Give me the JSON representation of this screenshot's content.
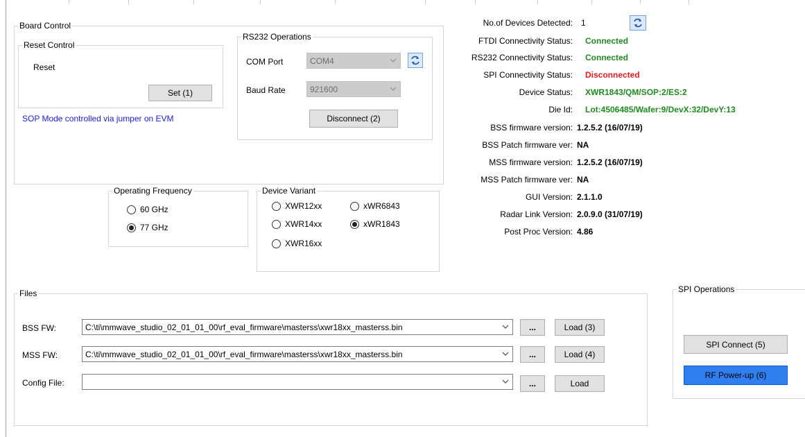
{
  "board_control": {
    "title": "Board Control",
    "reset_group": "Reset Control",
    "reset_label": "Reset",
    "set_button": "Set (1)",
    "sop_note": "SOP Mode controlled via jumper on EVM"
  },
  "rs232": {
    "title": "RS232 Operations",
    "com_port_label": "COM Port",
    "com_port_value": "COM4",
    "baud_rate_label": "Baud Rate",
    "baud_rate_value": "921600",
    "disconnect_button": "Disconnect (2)"
  },
  "operating_frequency": {
    "title": "Operating Frequency",
    "options": [
      {
        "label": "60 GHz",
        "selected": false
      },
      {
        "label": "77 GHz",
        "selected": true
      }
    ]
  },
  "device_variant": {
    "title": "Device Variant",
    "options": [
      {
        "label": "XWR12xx",
        "selected": false
      },
      {
        "label": "xWR6843",
        "selected": false
      },
      {
        "label": "XWR14xx",
        "selected": false
      },
      {
        "label": "xWR1843",
        "selected": true
      },
      {
        "label": "XWR16xx",
        "selected": false
      }
    ]
  },
  "status": {
    "rows": [
      {
        "label": "No.of Devices Detected:",
        "value": "1",
        "color": "#000000"
      },
      {
        "label": "FTDI Connectivity Status:",
        "value": "Connected",
        "color": "#1e8c1e"
      },
      {
        "label": "RS232 Connectivity Status:",
        "value": "Connected",
        "color": "#1e8c1e"
      },
      {
        "label": "SPI Connectivity Status:",
        "value": "Disconnected",
        "color": "#e81c1c"
      },
      {
        "label": "Device Status:",
        "value": "XWR1843/QM/SOP:2/ES:2",
        "color": "#1e8c1e"
      },
      {
        "label": "Die Id:",
        "value": "Lot:4506485/Wafer:9/DevX:32/DevY:13",
        "color": "#1e8c1e"
      },
      {
        "label": "BSS firmware version:",
        "value": "1.2.5.2 (16/07/19)",
        "color": "#000000"
      },
      {
        "label": "BSS Patch firmware ver:",
        "value": "NA",
        "color": "#000000"
      },
      {
        "label": "MSS firmware version:",
        "value": "1.2.5.2 (16/07/19)",
        "color": "#000000"
      },
      {
        "label": "MSS Patch firmware ver:",
        "value": "NA",
        "color": "#000000"
      },
      {
        "label": "GUI Version:",
        "value": "2.1.1.0",
        "color": "#000000"
      },
      {
        "label": "Radar Link Version:",
        "value": "2.0.9.0 (31/07/19)",
        "color": "#000000"
      },
      {
        "label": "Post Proc Version:",
        "value": "4.86",
        "color": "#000000"
      }
    ]
  },
  "files": {
    "title": "Files",
    "bss_label": "BSS FW:",
    "bss_value": "C:\\ti\\mmwave_studio_02_01_01_00\\rf_eval_firmware\\masterss\\xwr18xx_masterss.bin",
    "bss_load": "Load (3)",
    "mss_label": "MSS FW:",
    "mss_value": "C:\\ti\\mmwave_studio_02_01_01_00\\rf_eval_firmware\\masterss\\xwr18xx_masterss.bin",
    "mss_load": "Load (4)",
    "config_label": "Config File:",
    "config_value": "",
    "config_load": "Load",
    "browse": "..."
  },
  "spi": {
    "title": "SPI Operations",
    "connect_button": "SPI Connect (5)",
    "rf_powerup_button": "RF Power-up (6)"
  }
}
